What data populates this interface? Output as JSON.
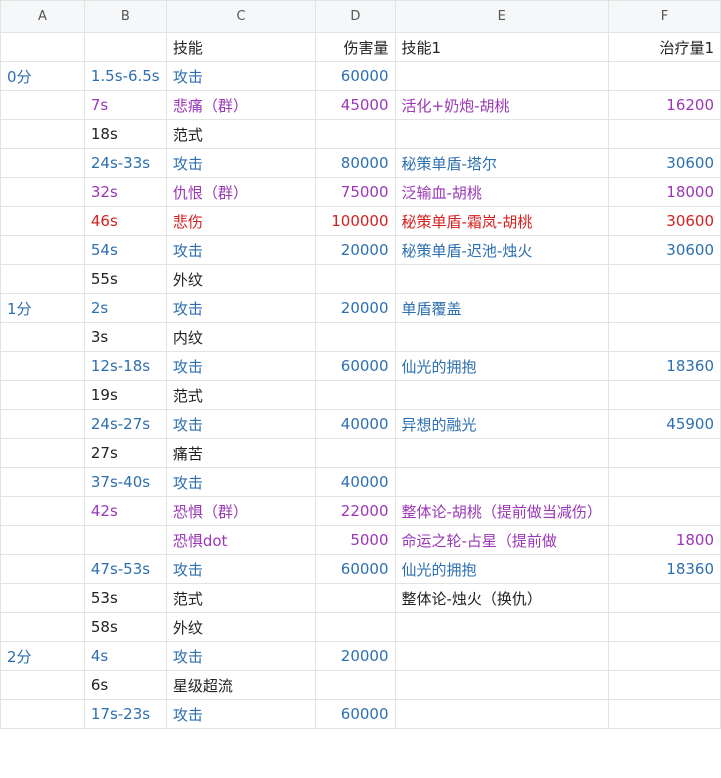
{
  "columns": [
    "A",
    "B",
    "C",
    "D",
    "E",
    "F"
  ],
  "colors": {
    "blue": "#2e6fb0",
    "purple": "#9b37b8",
    "red": "#d42121",
    "black": "#222222",
    "gridline": "#e2e3e3"
  },
  "rows": [
    {
      "a": "",
      "b": "",
      "c": "技能",
      "d": "伤害量",
      "e": "技能1",
      "f": "治疗量1",
      "color": "black"
    },
    {
      "a": "0分",
      "b": "1.5s-6.5s",
      "c": "攻击",
      "d": "60000",
      "e": "",
      "f": "",
      "color": "blue"
    },
    {
      "a": "",
      "b": "7s",
      "c": "悲痛（群）",
      "d": "45000",
      "e": "活化+奶炮-胡桃",
      "f": "16200",
      "color": "purple"
    },
    {
      "a": "",
      "b": "18s",
      "c": "范式",
      "d": "",
      "e": "",
      "f": "",
      "color": "black"
    },
    {
      "a": "",
      "b": "24s-33s",
      "c": "攻击",
      "d": "80000",
      "e": "秘策单盾-塔尔",
      "f": "30600",
      "color": "blue"
    },
    {
      "a": "",
      "b": "32s",
      "c": "仇恨（群）",
      "d": "75000",
      "e": "泛输血-胡桃",
      "f": "18000",
      "color": "purple"
    },
    {
      "a": "",
      "b": "46s",
      "c": "悲伤",
      "d": "100000",
      "e": "秘策单盾-霜岚-胡桃",
      "f": "30600",
      "color": "red"
    },
    {
      "a": "",
      "b": "54s",
      "c": "攻击",
      "d": "20000",
      "e": "秘策单盾-迟池-烛火",
      "f": "30600",
      "color": "blue"
    },
    {
      "a": "",
      "b": "55s",
      "c": "外纹",
      "d": "",
      "e": "",
      "f": "",
      "color": "black"
    },
    {
      "a": "1分",
      "b": "2s",
      "c": "攻击",
      "d": "20000",
      "e": "单盾覆盖",
      "f": "",
      "color": "blue"
    },
    {
      "a": "",
      "b": "3s",
      "c": "内纹",
      "d": "",
      "e": "",
      "f": "",
      "color": "black"
    },
    {
      "a": "",
      "b": "12s-18s",
      "c": "攻击",
      "d": "60000",
      "e": "仙光的拥抱",
      "f": "18360",
      "color": "blue"
    },
    {
      "a": "",
      "b": "19s",
      "c": "范式",
      "d": "",
      "e": "",
      "f": "",
      "color": "black"
    },
    {
      "a": "",
      "b": "24s-27s",
      "c": "攻击",
      "d": "40000",
      "e": "异想的融光",
      "f": "45900",
      "color": "blue"
    },
    {
      "a": "",
      "b": "27s",
      "c": "痛苦",
      "d": "",
      "e": "",
      "f": "",
      "color": "black"
    },
    {
      "a": "",
      "b": "37s-40s",
      "c": "攻击",
      "d": "40000",
      "e": "",
      "f": "",
      "color": "blue"
    },
    {
      "a": "",
      "b": "42s",
      "c": "恐惧（群）",
      "d": "22000",
      "e": "整体论-胡桃（提前做当减伤）",
      "f": "",
      "color": "purple"
    },
    {
      "a": "",
      "b": "",
      "c": "恐惧dot",
      "d": "5000",
      "e": "命运之轮-占星（提前做",
      "f": "1800",
      "color": "purple"
    },
    {
      "a": "",
      "b": "47s-53s",
      "c": "攻击",
      "d": "60000",
      "e": "仙光的拥抱",
      "f": "18360",
      "color": "blue"
    },
    {
      "a": "",
      "b": "53s",
      "c": "范式",
      "d": "",
      "e": "整体论-烛火（换仇）",
      "f": "",
      "color": "black"
    },
    {
      "a": "",
      "b": "58s",
      "c": "外纹",
      "d": "",
      "e": "",
      "f": "",
      "color": "black"
    },
    {
      "a": "2分",
      "b": "4s",
      "c": "攻击",
      "d": "20000",
      "e": "",
      "f": "",
      "color": "blue"
    },
    {
      "a": "",
      "b": "6s",
      "c": "星级超流",
      "d": "",
      "e": "",
      "f": "",
      "color": "black"
    },
    {
      "a": "",
      "b": "17s-23s",
      "c": "攻击",
      "d": "60000",
      "e": "",
      "f": "",
      "color": "blue"
    }
  ]
}
